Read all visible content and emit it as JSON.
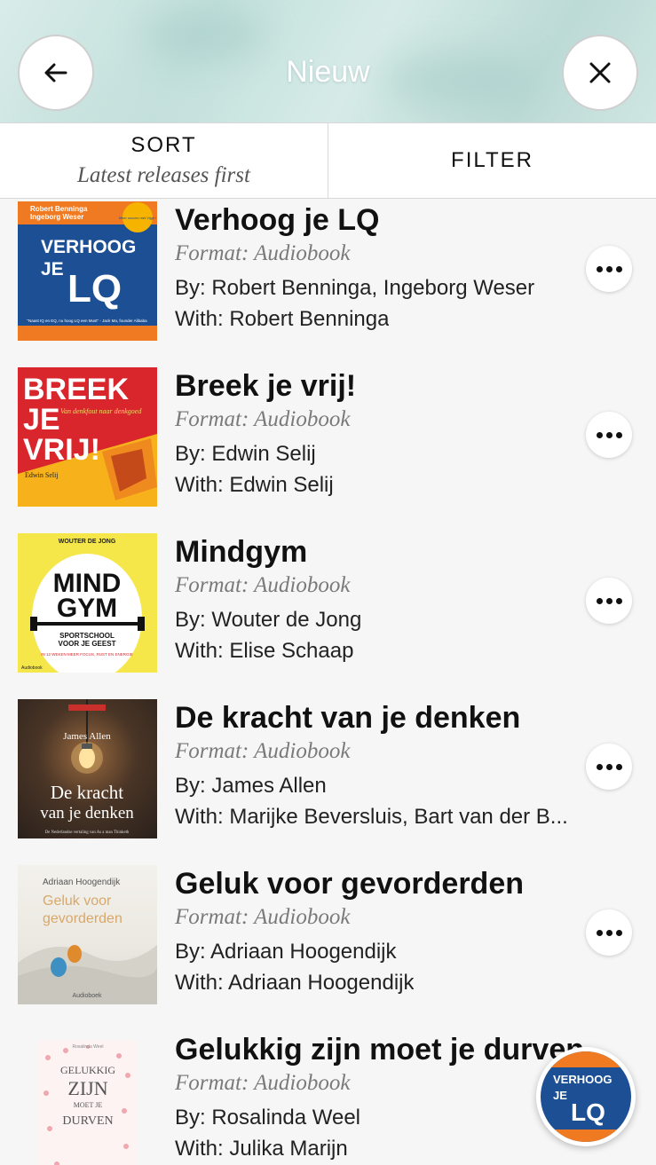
{
  "header": {
    "title": "Nieuw",
    "back_icon": "arrow-left-icon",
    "close_icon": "close-icon"
  },
  "toolbar": {
    "sort_label": "SORT",
    "sort_value": "Latest releases first",
    "filter_label": "FILTER"
  },
  "books": [
    {
      "title": "Verhoog je LQ",
      "format": "Format: Audiobook",
      "by": "By: Robert Benninga, Ingeborg Weser",
      "with": "With: Robert Benninga",
      "cover": {
        "authors": "Robert Benninga\nIngeborg Weser",
        "line1": "VERHOOG",
        "line2": "JE",
        "line3": "LQ",
        "badge": "Meer succes met Vijge !",
        "quote": "\"Naast IQ en EQ, nu hoog LQ een Must\" - Jack Ma, founder Alibaba"
      }
    },
    {
      "title": "Breek je vrij!",
      "format": "Format: Audiobook",
      "by": "By: Edwin Selij",
      "with": "With: Edwin Selij",
      "cover": {
        "line1": "BREEK",
        "line2": "JE",
        "line3": "VRIJ!",
        "subtitle": "Van denkfout naar denkgoed",
        "author": "Edwin Selij"
      }
    },
    {
      "title": "Mindgym",
      "format": "Format: Audiobook",
      "by": "By: Wouter de Jong",
      "with": "With: Elise Schaap",
      "cover": {
        "author": "WOUTER DE JONG",
        "line1": "MIND",
        "line2": "GYM",
        "subtitle": "SPORTSCHOOL\nVOOR JE GEEST",
        "tagline": "IN 12 WEKEN MEER FOCUS, RUST EN ENERGIE",
        "label": "Audiobook"
      }
    },
    {
      "title": "De kracht van je denken",
      "format": "Format: Audiobook",
      "by": "By: James Allen",
      "with": "With: Marijke Beversluis, Bart van der B...",
      "cover": {
        "author": "James Allen",
        "line1": "De kracht",
        "line2": "van je denken",
        "subtitle": "De Nederlandse vertaling van As a man Thinketh"
      }
    },
    {
      "title": "Geluk voor gevorderden",
      "format": "Format: Audiobook",
      "by": "By: Adriaan Hoogendijk",
      "with": "With: Adriaan Hoogendijk",
      "cover": {
        "author": "Adriaan Hoogendijk",
        "line1": "Geluk voor",
        "line2": "gevorderden",
        "label": "Audioboek"
      }
    },
    {
      "title": "Gelukkig zijn moet je durven",
      "format": "Format: Audiobook",
      "by": "By: Rosalinda Weel",
      "with": "With: Julika Marijn",
      "cover": {
        "author": "Rosalinda Weel",
        "line1": "GELUKKIG",
        "line2": "ZIJN",
        "line3": "MOET JE",
        "line4": "DURVEN"
      }
    }
  ],
  "mini_player": {
    "line1": "VERHOOG",
    "line2": "JE",
    "line3": "LQ"
  },
  "colors": {
    "header_bg": "#cfe6e2",
    "background": "#f6f6f6",
    "cover_lq_blue": "#1c4f93",
    "cover_lq_orange": "#f07a22",
    "cover_breek_red": "#d8262c",
    "cover_mindgym_yellow": "#f5e64a"
  }
}
